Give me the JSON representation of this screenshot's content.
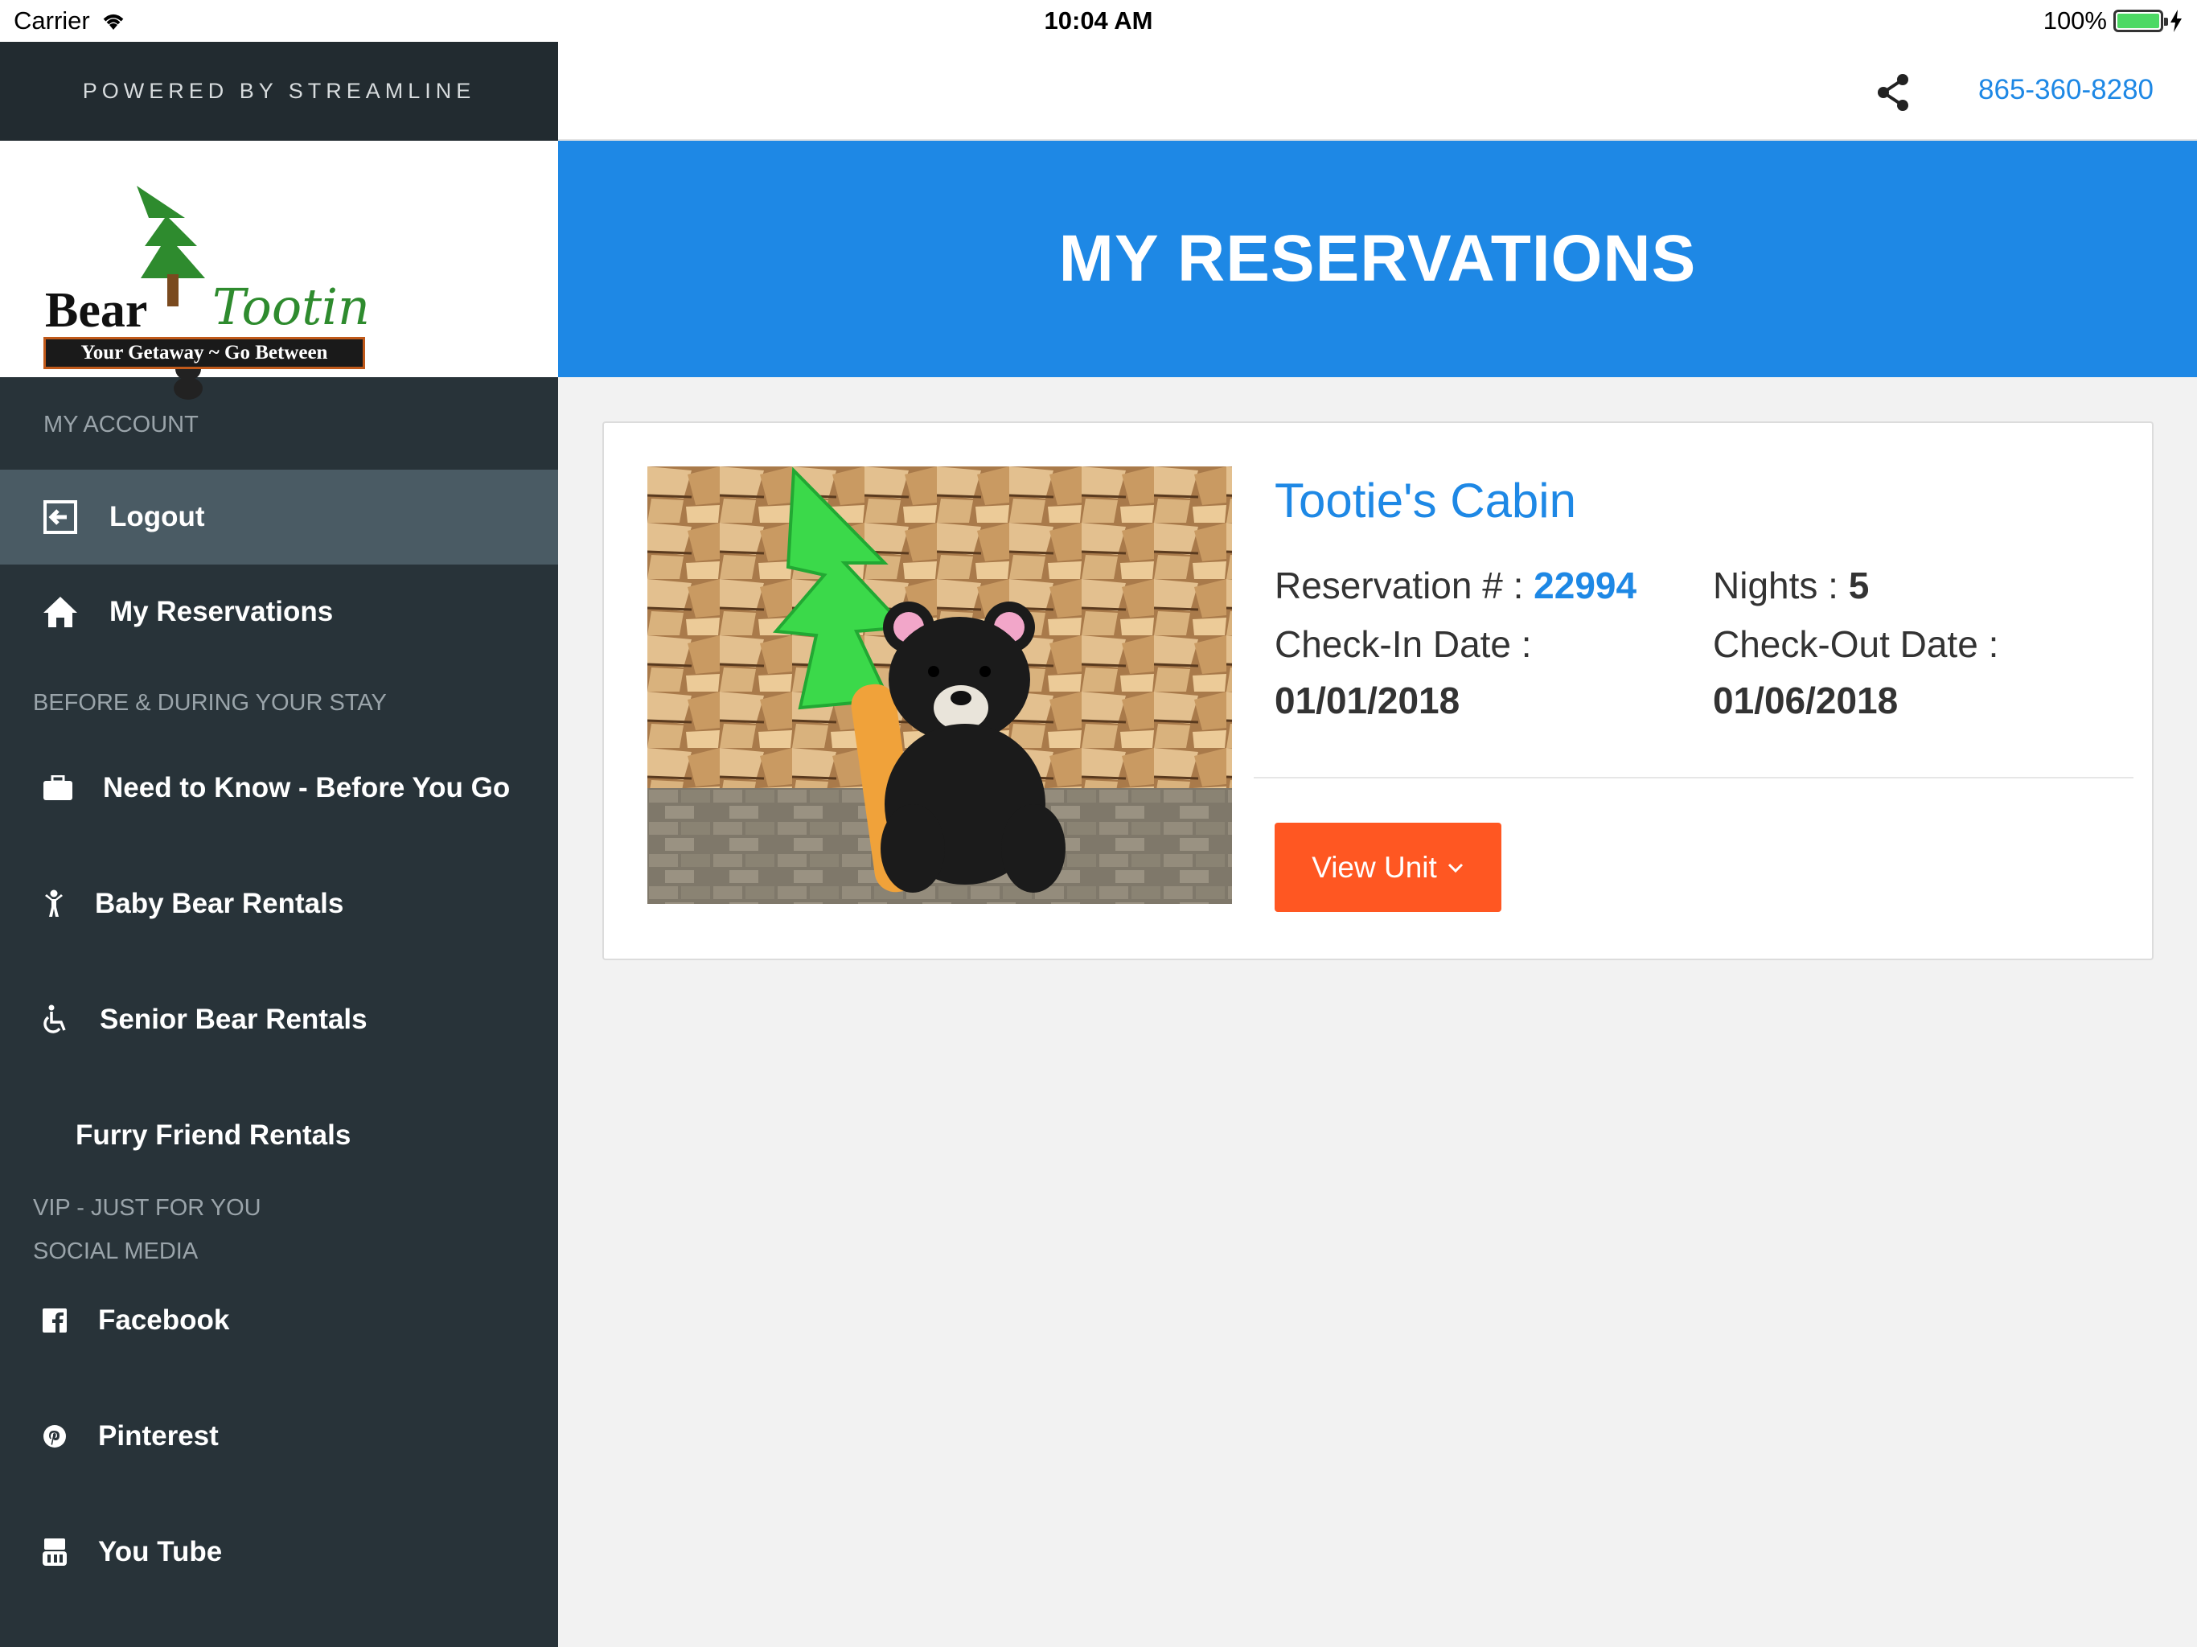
{
  "status_bar": {
    "carrier": "Carrier",
    "time": "10:04 AM",
    "battery": "100%"
  },
  "sidebar": {
    "powered_by": "POWERED BY STREAMLINE",
    "logo": {
      "word1": "Bear",
      "word2": "Tootin",
      "tagline": "Your Getaway ~ Go Between"
    },
    "sections": {
      "my_account": "MY ACCOUNT",
      "before_during": "BEFORE & DURING YOUR STAY",
      "vip": "VIP - JUST FOR YOU",
      "social": "SOCIAL MEDIA"
    },
    "items": {
      "logout": {
        "label": "Logout",
        "icon": "logout-icon"
      },
      "my_reservations": {
        "label": "My Reservations",
        "icon": "home-icon"
      },
      "need_to_know": {
        "label": "Need to Know - Before You Go",
        "icon": "briefcase-icon"
      },
      "baby_bear": {
        "label": "Baby Bear Rentals",
        "icon": "child-icon"
      },
      "senior_bear": {
        "label": "Senior Bear Rentals",
        "icon": "wheelchair-icon"
      },
      "furry_friend": {
        "label": "Furry Friend Rentals"
      },
      "facebook": {
        "label": "Facebook",
        "icon": "facebook-icon"
      },
      "pinterest": {
        "label": "Pinterest",
        "icon": "pinterest-icon"
      },
      "youtube": {
        "label": "You Tube",
        "icon": "youtube-icon"
      }
    }
  },
  "topbar": {
    "phone": "865-360-8280",
    "share_icon": "share-icon"
  },
  "banner": {
    "title": "MY RESERVATIONS"
  },
  "reservation": {
    "unit_name": "Tootie's Cabin",
    "reservation_label": "Reservation # :",
    "reservation_number": "22994",
    "nights_label": "Nights :",
    "nights": "5",
    "checkin_label": "Check-In Date :",
    "checkin": "01/01/2018",
    "checkout_label": "Check-Out Date :",
    "checkout": "01/06/2018",
    "view_unit_label": "View Unit"
  },
  "colors": {
    "sidebar_bg": "#283339",
    "accent_blue": "#1e88e5",
    "button_orange": "#ff5722"
  }
}
